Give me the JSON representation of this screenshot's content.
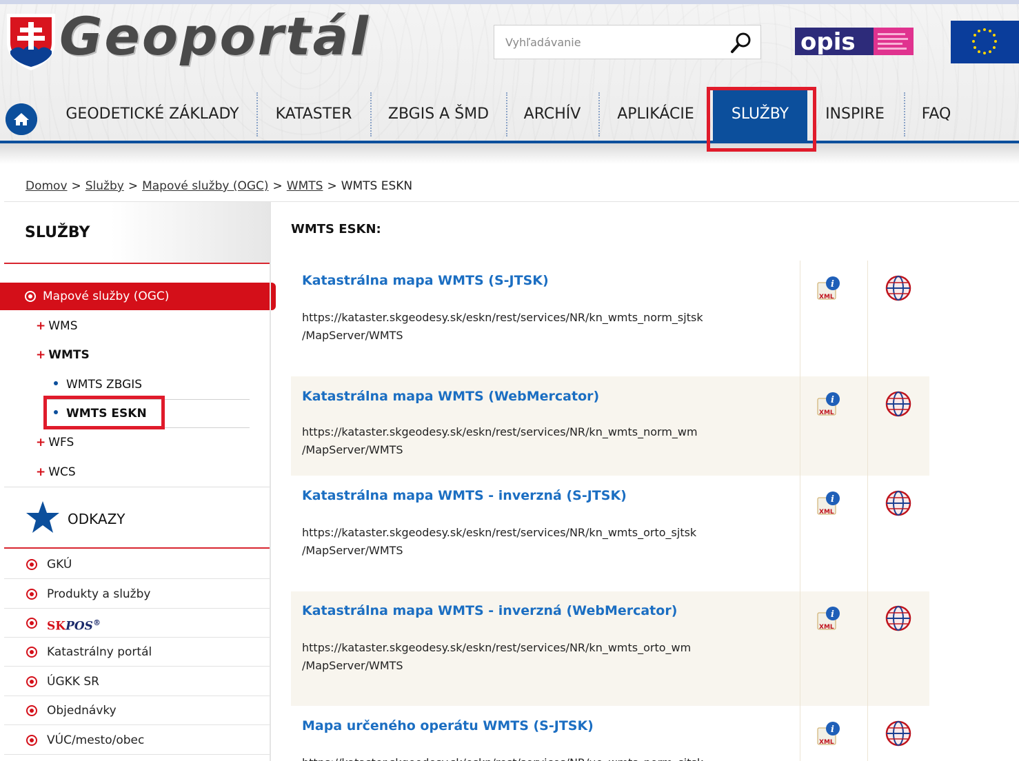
{
  "header": {
    "logo_text": "Geoportál",
    "search_placeholder": "Vyhľadávanie",
    "opis_text": "opis"
  },
  "nav": {
    "items": [
      "GEODETICKÉ ZÁKLADY",
      "KATASTER",
      "ZBGIS A ŠMD",
      "ARCHÍV",
      "APLIKÁCIE",
      "SLUŽBY",
      "INSPIRE",
      "FAQ"
    ],
    "active": "SLUŽBY"
  },
  "breadcrumb": {
    "items": [
      "Domov",
      "Služby",
      "Mapové služby (OGC)",
      "WMTS"
    ],
    "current": "WMTS ESKN",
    "separator": ">"
  },
  "sidebar": {
    "title": "SLUŽBY",
    "active_item": "Mapové služby (OGC)",
    "sub_items": [
      "WMS",
      "WMTS",
      "WFS",
      "WCS"
    ],
    "wmts_children": [
      "WMTS ZBGIS",
      "WMTS ESKN"
    ],
    "links_title": "ODKAZY",
    "links": [
      "GKÚ",
      "Produkty a služby",
      "SKPOS",
      "Katastrálny portál",
      "ÚGKK SR",
      "Objednávky",
      "VÚC/mesto/obec"
    ],
    "skpos": {
      "sk": "SK",
      "pos": "POS",
      "reg": "®"
    }
  },
  "main": {
    "title": "WMTS ESKN:",
    "services": [
      {
        "name": "Katastrálna mapa WMTS (S-JTSK)",
        "url1": "https://kataster.skgeodesy.sk/eskn/rest/services/NR/kn_wmts_norm_sjtsk",
        "url2": "/MapServer/WMTS"
      },
      {
        "name": "Katastrálna mapa WMTS (WebMercator)",
        "url1": "https://kataster.skgeodesy.sk/eskn/rest/services/NR/kn_wmts_norm_wm",
        "url2": "/MapServer/WMTS"
      },
      {
        "name": "Katastrálna mapa WMTS - inverzná (S-JTSK)",
        "url1": "https://kataster.skgeodesy.sk/eskn/rest/services/NR/kn_wmts_orto_sjtsk",
        "url2": "/MapServer/WMTS"
      },
      {
        "name": "Katastrálna mapa WMTS - inverzná (WebMercator)",
        "url1": "https://kataster.skgeodesy.sk/eskn/rest/services/NR/kn_wmts_orto_wm",
        "url2": "/MapServer/WMTS"
      },
      {
        "name": "Mapa určeného operátu WMTS (S-JTSK)",
        "url1": "https://kataster.skgeodesy.sk/eskn/rest/services/NR/uo_wmts_norm_sjtsk",
        "url2": ""
      }
    ]
  },
  "colors": {
    "brand_blue": "#0c4f9c",
    "accent_red": "#d40f19",
    "link_blue": "#1b6ec2",
    "highlight_red": "#e01b2b"
  },
  "icons": {
    "home": "home-icon",
    "search": "search-icon",
    "xml": "xml-info-icon",
    "globe": "globe-icon",
    "star": "star-icon"
  }
}
